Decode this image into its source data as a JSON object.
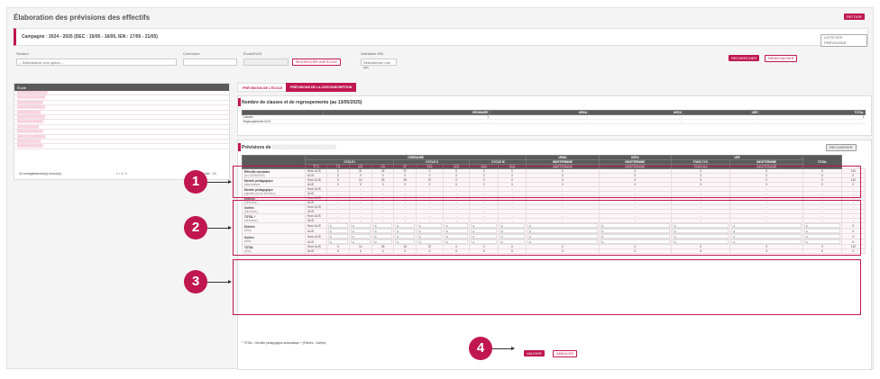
{
  "title": "Élaboration des prévisions des effectifs",
  "retour": "RETOUR",
  "campagne": "Campagne : 2024 - 2025 (DEC : 15/05 - 16/05, IEN : 17/05 - 21/05)",
  "liste_btn": "LISTE DES PRÉVISIONS",
  "filters": {
    "secteur_label": "Secteur",
    "secteur_value": "-- Sélectionner une option --",
    "commune_label": "Commune",
    "ecole_label": "École/IDAS",
    "rech_ecole": "RECHERCHER UNE ÉCOLE",
    "valid_label": "Validation IEN",
    "valid_value": "Sélectionner une opt.",
    "rechercher": "RECHERCHER",
    "reinit": "RÉINITIALISER"
  },
  "list": {
    "header": "École",
    "footer": "44 enregistrement(s) trouvé(s)",
    "page": "1",
    "per_page": "Afficher : 10"
  },
  "tabs": [
    "PRÉVISIONS DE L'ÉCOLE",
    "PRÉVISIONS DE LA CIRCONSCRIPTION"
  ],
  "classes": {
    "title": "Nombre de classes et de regroupements (au 13/05/2025)",
    "headers": [
      "",
      "ORDINAIRE",
      "UEMA",
      "UEEA",
      "UEE",
      "TOTAL"
    ],
    "rows": [
      [
        "Classes",
        "1",
        "-",
        "-",
        "-",
        "1"
      ],
      [
        "Regroupements ULIS",
        "-",
        "-",
        "-",
        "-",
        "-"
      ]
    ]
  },
  "prev": {
    "title": "Prévisions de",
    "recharger": "RECHARGER",
    "groups": [
      "ORDINAIRE",
      "UEMA",
      "UEEA",
      "UEE"
    ],
    "cycles": [
      "CYCLE I",
      "CYCLE II",
      "CYCLE III",
      "INDETERMINE",
      "INDETERMINE",
      "TOUS CYC.",
      "INDETERMINE",
      "TOTAL"
    ],
    "cols": [
      "TPS",
      "PS",
      "MS",
      "GS",
      "CP",
      "CE1",
      "CE2",
      "CM1",
      "CM2",
      "INDETERMINE",
      "INDETERMINE",
      "TOUS NIV.",
      "INDETERMINE"
    ],
    "block1": [
      {
        "label": "Effectifs constatés",
        "sub": "(au 13/05/2025)",
        "r1": "Hors ULIS",
        "r2": "ULIS",
        "v1": [
          "0",
          "31",
          "26",
          "37",
          "0",
          "0",
          "0",
          "0",
          "0",
          "0",
          "0",
          "0",
          "0",
          "110"
        ],
        "v2": [
          "0",
          "0",
          "0",
          "0",
          "0",
          "0",
          "0",
          "0",
          "0",
          "0",
          "0",
          "0",
          "0",
          "0"
        ]
      },
      {
        "label": "Montée pédagogique",
        "sub": "automatique",
        "r1": "Hors ULIS",
        "r2": "ULIS",
        "v1": [
          "0",
          "14",
          "33",
          "26",
          "37",
          "0",
          "0",
          "0",
          "0",
          "0",
          "0",
          "0",
          "0",
          "110"
        ],
        "v2": [
          "0",
          "0",
          "0",
          "0",
          "0",
          "0",
          "0",
          "0",
          "0",
          "0",
          "0",
          "0",
          "0",
          "0"
        ]
      }
    ],
    "block2": [
      {
        "label": "Montée pédagogique",
        "sub": "(ajustée par le directeur)"
      },
      {
        "label": "Entrées",
        "sub": "(directeur)"
      },
      {
        "label": "Sorties",
        "sub": "(directeur)"
      },
      {
        "label": "TOTAL *",
        "sub": "(directeur)"
      }
    ],
    "block3": [
      {
        "label": "Entrées",
        "sub": "(IEN)"
      },
      {
        "label": "Sorties",
        "sub": "(IEN)"
      }
    ],
    "total": {
      "label": "TOTAL",
      "sub": "(IEN)",
      "v1": [
        "0",
        "14",
        "33",
        "26",
        "37",
        "0",
        "0",
        "0",
        "0",
        "0",
        "0",
        "0",
        "0",
        "110"
      ],
      "v2": [
        "0",
        "0",
        "0",
        "0",
        "0",
        "0",
        "0",
        "0",
        "0",
        "0",
        "0",
        "0",
        "0",
        "0"
      ],
      "grand": "110"
    },
    "hors": "Hors ULIS",
    "ulis": "ULIS",
    "note": "* TOTAL = Montée pédagogique automatique + (Entrées - Sorties)"
  },
  "valider": "VALIDER",
  "annuler": "ANNULER",
  "callouts": [
    "1",
    "2",
    "3",
    "4"
  ]
}
